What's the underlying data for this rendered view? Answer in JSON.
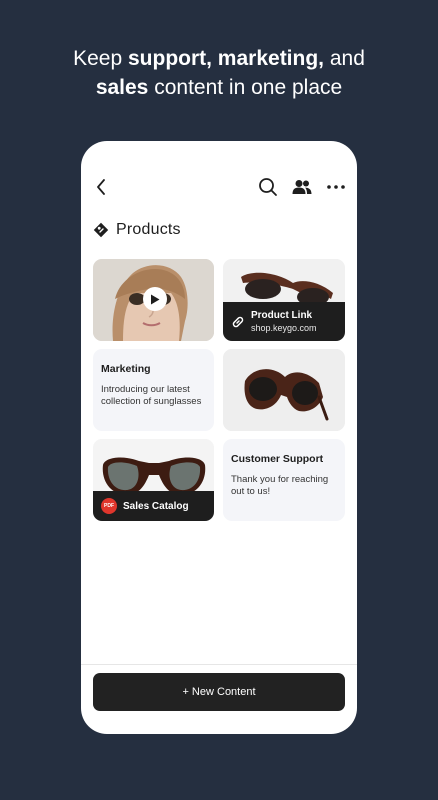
{
  "headline": {
    "line1_pre": "Keep ",
    "line1_bold": "support, marketing,",
    "line1_post": " and",
    "line2_bold": "sales",
    "line2_post": " content in one place"
  },
  "topbar": {
    "icons": [
      "back-icon",
      "search-icon",
      "users-icon",
      "more-icon"
    ]
  },
  "section": {
    "title": "Products",
    "icon": "tag-icon"
  },
  "cards": {
    "video": {
      "icon": "play-icon"
    },
    "product_link": {
      "title": "Product Link",
      "url": "shop.keygo.com",
      "icon": "link-icon"
    },
    "marketing": {
      "title": "Marketing",
      "body": "Introducing our latest collection of sunglasses"
    },
    "sunglasses_photo": {},
    "sales_catalog": {
      "title": "Sales Catalog",
      "badge": "PDF"
    },
    "customer_support": {
      "title": "Customer Support",
      "body": "Thank you for reaching out to us!"
    }
  },
  "footer": {
    "new_content_label": "+ New Content"
  },
  "colors": {
    "background": "#252f40",
    "dark": "#1e1e1e",
    "card_bg": "#f4f5f9",
    "pdf_red": "#e0362c"
  }
}
